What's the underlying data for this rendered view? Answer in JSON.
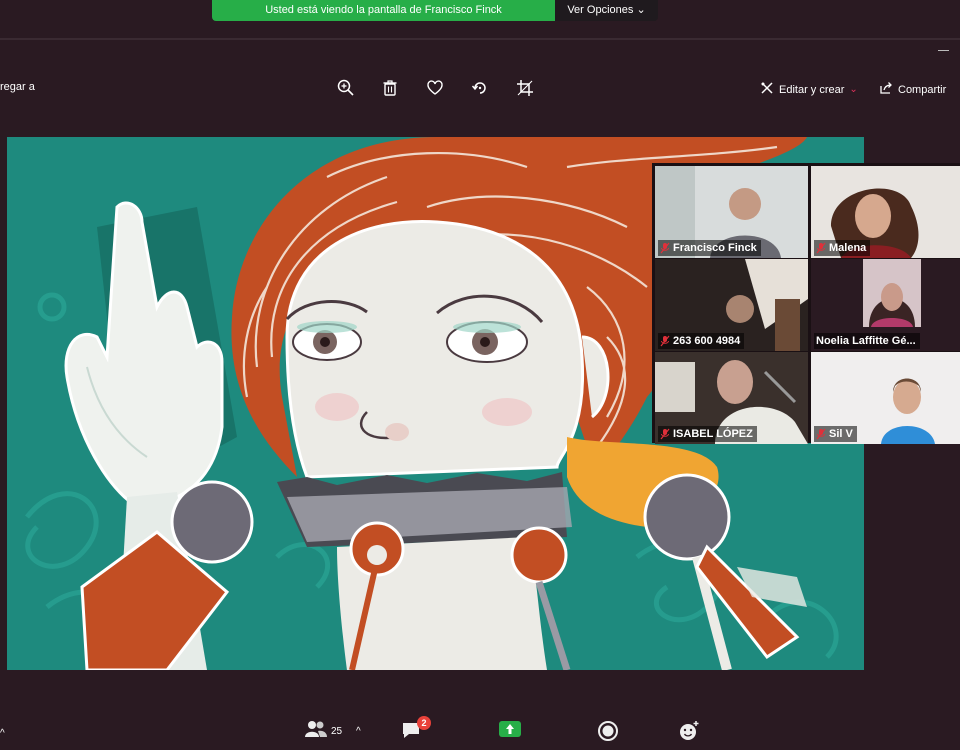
{
  "share_banner": {
    "message": "Usted está viendo la pantalla de Francisco Finck",
    "options_label": "Ver Opciones"
  },
  "toolbar": {
    "left_text": "regar a",
    "edit_create_label": "Editar y crear",
    "share_label": "Compartir",
    "icons": [
      "zoom-in-icon",
      "trash-icon",
      "heart-icon",
      "rotate-icon",
      "crop-icon"
    ]
  },
  "participants": [
    {
      "name": "Francisco Finck",
      "muted": true
    },
    {
      "name": "Malena",
      "muted": true
    },
    {
      "name": "263 600 4984",
      "muted": true
    },
    {
      "name": "Noelia Laffitte Gé...",
      "muted": false,
      "active": true
    },
    {
      "name": "ISABEL LÓPEZ",
      "muted": true
    },
    {
      "name": "Sil V",
      "muted": true
    }
  ],
  "bottom_bar": {
    "participants_count": "25",
    "chat_badge": "2",
    "labels": [
      "Participantes",
      "Chat",
      "Compartir pantalla",
      "Grabar",
      "Reacciones"
    ]
  },
  "colors": {
    "banner_green": "#27ae48",
    "artwork_teal": "#1e8a7e",
    "hair_orange": "#c24e23",
    "active_tile_border": "#d8e87a",
    "mute_red": "#e0303a",
    "chat_badge": "#e8413a"
  }
}
